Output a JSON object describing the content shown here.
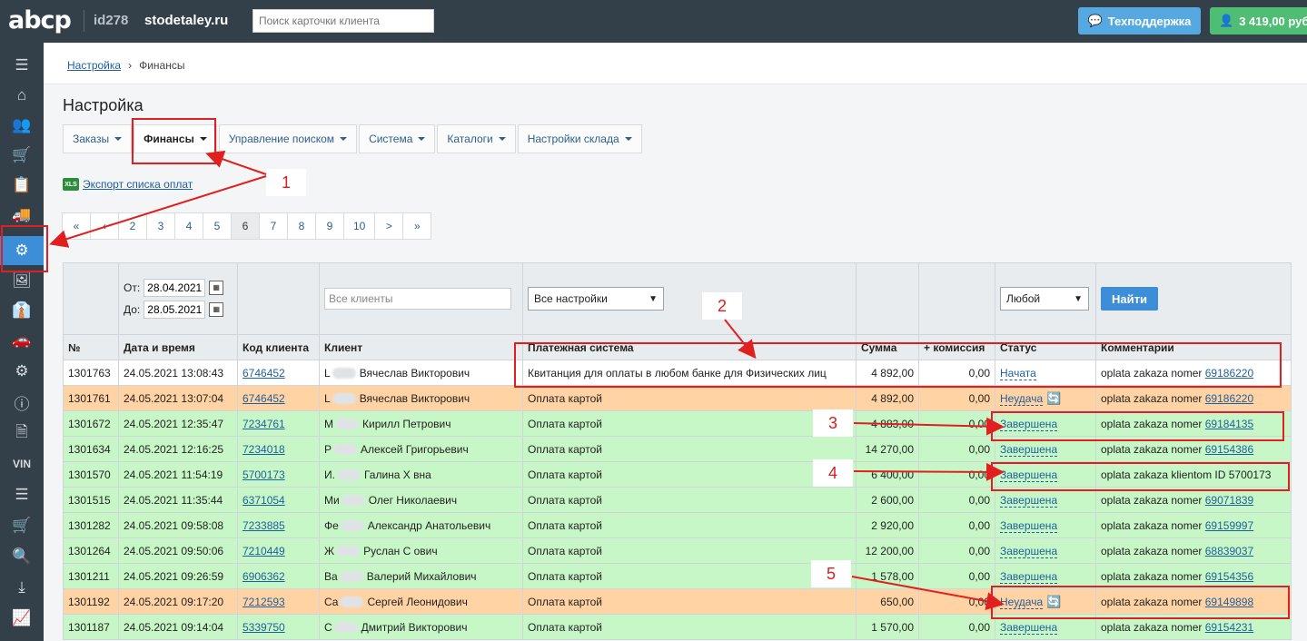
{
  "topbar": {
    "logo": "abcp",
    "site_id": "id278",
    "site_name": "stodetaley.ru",
    "search_placeholder": "Поиск карточки клиента",
    "support_label": "Техподдержка",
    "balance_label": "3 419,00 руб"
  },
  "sidebar": {
    "vin_label": "VIN",
    "items": [
      "menu-icon",
      "home-icon",
      "users-icon",
      "cart-icon",
      "clipboard-icon",
      "truck-icon",
      "gear-icon",
      "image-icon",
      "user-tie-icon",
      "car-icon",
      "gears-icon",
      "info-icon",
      "excel-icon",
      "vin",
      "layers-icon",
      "cart-plus-icon",
      "search-car-icon",
      "download-icon",
      "report-icon"
    ],
    "active": "gear-icon"
  },
  "breadcrumb": {
    "parent": "Настройка",
    "current": "Финансы"
  },
  "page": {
    "title": "Настройка"
  },
  "tabs": [
    {
      "label": "Заказы"
    },
    {
      "label": "Финансы"
    },
    {
      "label": "Управление поиском"
    },
    {
      "label": "Система"
    },
    {
      "label": "Каталоги"
    },
    {
      "label": "Настройки склада"
    }
  ],
  "export": {
    "icon_text": "XLS",
    "label": "Экспорт списка оплат"
  },
  "pagination": [
    "«",
    "‹",
    "2",
    "3",
    "4",
    "5",
    "6",
    "7",
    "8",
    "9",
    "10",
    ">",
    "»"
  ],
  "pagination_current": "6",
  "filters": {
    "from_label": "От:",
    "from_value": "28.04.2021",
    "to_label": "До:",
    "to_value": "28.05.2021",
    "client_placeholder": "Все клиенты",
    "settings_value": "Все настройки",
    "status_value": "Любой",
    "find_label": "Найти"
  },
  "columns": [
    "№",
    "Дата и время",
    "Код клиента",
    "Клиент",
    "Платежная система",
    "Сумма",
    "+ комиссия",
    "Статус",
    "Комментарии"
  ],
  "rows": [
    {
      "id": "1301763",
      "datetime": "24.05.2021 13:08:43",
      "client_code": "6746452",
      "client_initial": "L",
      "client_name": "Вячеслав Викторович",
      "payment": "Квитанция для оплаты в любом банке для Физических лиц",
      "amount": "4 892,00",
      "commission": "0,00",
      "status": "Начата",
      "comment_text": "oplata zakaza nomer",
      "comment_link": "69186220",
      "row_color": "white"
    },
    {
      "id": "1301761",
      "datetime": "24.05.2021 13:07:04",
      "client_code": "6746452",
      "client_initial": "L",
      "client_name": "Вячеслав Викторович",
      "payment": "Оплата картой",
      "amount": "4 892,00",
      "commission": "0,00",
      "status": "Неудача",
      "comment_text": "oplata zakaza nomer",
      "comment_link": "69186220",
      "row_color": "orange"
    },
    {
      "id": "1301672",
      "datetime": "24.05.2021 12:35:47",
      "client_code": "7234761",
      "client_initial": "М",
      "client_name": "Кирилл Петрович",
      "payment": "Оплата картой",
      "amount": "4 883,00",
      "commission": "0,00",
      "status": "Завершена",
      "comment_text": "oplata zakaza nomer",
      "comment_link": "69184135",
      "row_color": "green"
    },
    {
      "id": "1301634",
      "datetime": "24.05.2021 12:16:25",
      "client_code": "7234018",
      "client_initial": "Р",
      "client_name": "Алексей Григорьевич",
      "payment": "Оплата картой",
      "amount": "14 270,00",
      "commission": "0,00",
      "status": "Завершена",
      "comment_text": "oplata zakaza nomer",
      "comment_link": "69154386",
      "row_color": "green"
    },
    {
      "id": "1301570",
      "datetime": "24.05.2021 11:54:19",
      "client_code": "5700173",
      "client_initial": "И.",
      "client_name": "Галина Х      вна",
      "payment": "Оплата картой",
      "amount": "6 400,00",
      "commission": "0,00",
      "status": "Завершена",
      "comment_text": "oplata zakaza klientom ID 5700173",
      "comment_link": "",
      "row_color": "green"
    },
    {
      "id": "1301515",
      "datetime": "24.05.2021 11:35:44",
      "client_code": "6371054",
      "client_initial": "Ми",
      "client_name": "Олег Николаевич",
      "payment": "Оплата картой",
      "amount": "2 600,00",
      "commission": "0,00",
      "status": "Завершена",
      "comment_text": "oplata zakaza nomer",
      "comment_link": "69071839",
      "row_color": "green"
    },
    {
      "id": "1301282",
      "datetime": "24.05.2021 09:58:08",
      "client_code": "7233885",
      "client_initial": "Фе",
      "client_name": "Александр Анатольевич",
      "payment": "Оплата картой",
      "amount": "2 920,00",
      "commission": "0,00",
      "status": "Завершена",
      "comment_text": "oplata zakaza nomer",
      "comment_link": "69159997",
      "row_color": "green"
    },
    {
      "id": "1301264",
      "datetime": "24.05.2021 09:50:06",
      "client_code": "7210449",
      "client_initial": "Ж",
      "client_name": "Руслан С     ович",
      "payment": "Оплата картой",
      "amount": "12 200,00",
      "commission": "0,00",
      "status": "Завершена",
      "comment_text": "oplata zakaza nomer",
      "comment_link": "68839037",
      "row_color": "green"
    },
    {
      "id": "1301211",
      "datetime": "24.05.2021 09:26:59",
      "client_code": "6906362",
      "client_initial": "Ва",
      "client_name": "Валерий Михайлович",
      "payment": "Оплата картой",
      "amount": "1 578,00",
      "commission": "0,00",
      "status": "Завершена",
      "comment_text": "oplata zakaza nomer",
      "comment_link": "69154356",
      "row_color": "green"
    },
    {
      "id": "1301192",
      "datetime": "24.05.2021 09:17:20",
      "client_code": "7212593",
      "client_initial": "Са",
      "client_name": "Сергей Леонидович",
      "payment": "Оплата картой",
      "amount": "650,00",
      "commission": "0,00",
      "status": "Неудача",
      "comment_text": "oplata zakaza nomer",
      "comment_link": "69149898",
      "row_color": "orange"
    },
    {
      "id": "1301187",
      "datetime": "24.05.2021 09:14:04",
      "client_code": "5339750",
      "client_initial": "С",
      "client_name": "Дмитрий Викторович",
      "payment": "Оплата картой",
      "amount": "1 570,00",
      "commission": "0,00",
      "status": "Завершена",
      "comment_text": "oplata zakaza nomer",
      "comment_link": "69154231",
      "row_color": "green"
    }
  ],
  "annotations": [
    "1",
    "2",
    "3",
    "4",
    "5"
  ],
  "colors": {
    "topbar": "#333f49",
    "accent": "#3c8ed6",
    "success_row": "#c7f7c7",
    "fail_row": "#ffd3a4",
    "annotation": "#e02020"
  }
}
